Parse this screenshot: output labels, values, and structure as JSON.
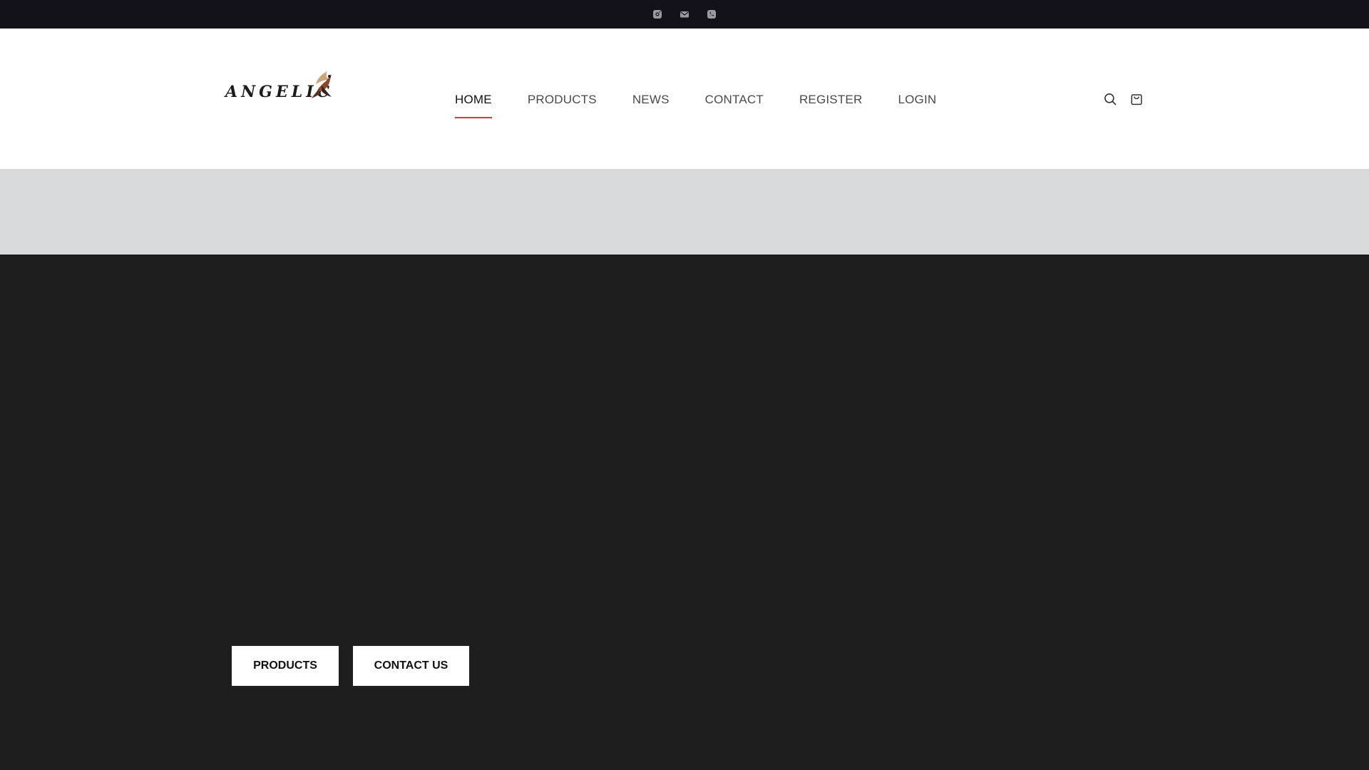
{
  "topbar": {
    "icons": [
      "instagram-icon",
      "mail-icon",
      "phone-icon"
    ],
    "icon_color": "#9a99a0",
    "background": "#13111a"
  },
  "header": {
    "logo_text": "ANGELIC",
    "nav": [
      {
        "label": "HOME",
        "active": true
      },
      {
        "label": "PRODUCTS",
        "active": false
      },
      {
        "label": "NEWS",
        "active": false
      },
      {
        "label": "CONTACT",
        "active": false
      },
      {
        "label": "REGISTER",
        "active": false
      },
      {
        "label": "LOGIN",
        "active": false
      }
    ],
    "active_underline_color": "#d63a3a",
    "icons": [
      "search-icon",
      "shopping-bag-icon"
    ]
  },
  "hero": {
    "background": "#1e1e1e",
    "strip_background": "#d9dadc",
    "buttons": {
      "products_label": "PRODUCTS",
      "contact_label": "CONTACT US"
    }
  }
}
